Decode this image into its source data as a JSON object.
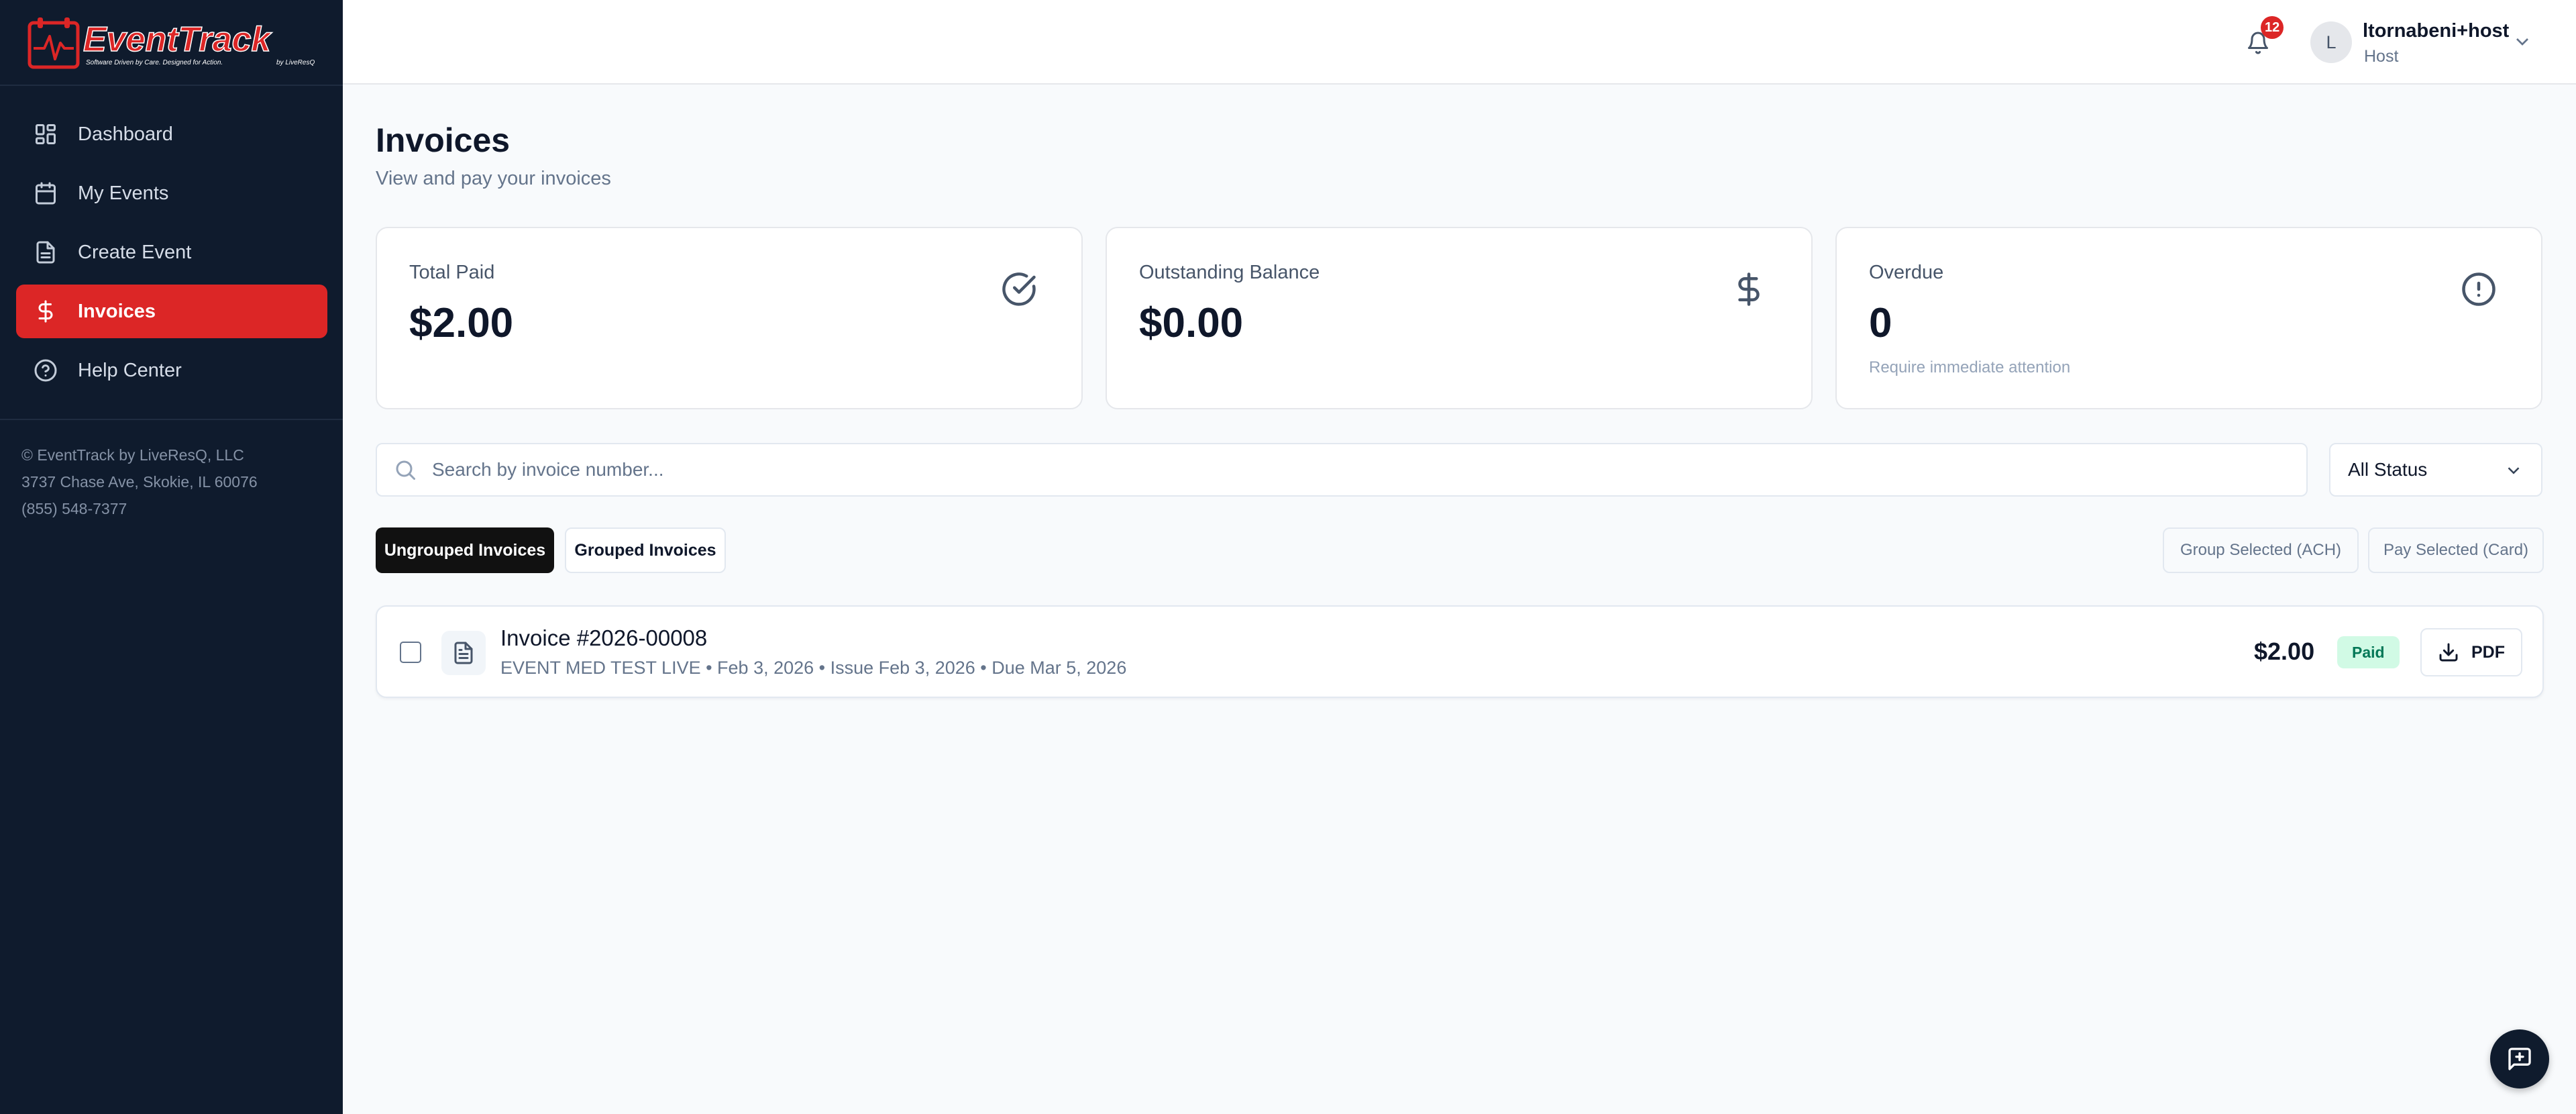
{
  "brand": {
    "name": "EventTrack",
    "tagline": "Software Driven by Care. Designed for Action.",
    "byline": "by LiveResQ",
    "accent": "#dc2626",
    "sidebar_bg": "#0f1b2d"
  },
  "sidebar": {
    "items": [
      {
        "label": "Dashboard",
        "icon": "grid-icon",
        "active": false
      },
      {
        "label": "My Events",
        "icon": "calendar-icon",
        "active": false
      },
      {
        "label": "Create Event",
        "icon": "document-icon",
        "active": false
      },
      {
        "label": "Invoices",
        "icon": "dollar-icon",
        "active": true
      },
      {
        "label": "Help Center",
        "icon": "help-circle-icon",
        "active": false
      }
    ],
    "footer": {
      "company": "© EventTrack by LiveResQ, LLC",
      "address": "3737 Chase Ave, Skokie, IL 60076",
      "phone": "(855) 548-7377"
    }
  },
  "header": {
    "notification_count": "12",
    "user": {
      "initial": "L",
      "name": "ltornabeni+host",
      "role": "Host"
    }
  },
  "page": {
    "title": "Invoices",
    "subtitle": "View and pay your invoices"
  },
  "stats": [
    {
      "label": "Total Paid",
      "value": "$2.00",
      "note": "",
      "icon": "check-circle-icon"
    },
    {
      "label": "Outstanding Balance",
      "value": "$0.00",
      "note": "",
      "icon": "dollar-icon"
    },
    {
      "label": "Overdue",
      "value": "0",
      "note": "Require immediate attention",
      "icon": "alert-circle-icon"
    }
  ],
  "filters": {
    "search_placeholder": "Search by invoice number...",
    "search_value": "",
    "status_selected": "All Status"
  },
  "tabs": [
    {
      "label": "Ungrouped Invoices",
      "active": true
    },
    {
      "label": "Grouped Invoices",
      "active": false
    }
  ],
  "actions": {
    "group_ach": "Group Selected (ACH)",
    "pay_card": "Pay Selected (Card)"
  },
  "invoices": [
    {
      "number": "Invoice #2026-00008",
      "meta": "EVENT MED TEST LIVE • Feb 3, 2026 • Issue Feb 3, 2026 • Due Mar 5, 2026",
      "amount": "$2.00",
      "status": "Paid",
      "pdf_label": "PDF",
      "checked": false
    }
  ]
}
